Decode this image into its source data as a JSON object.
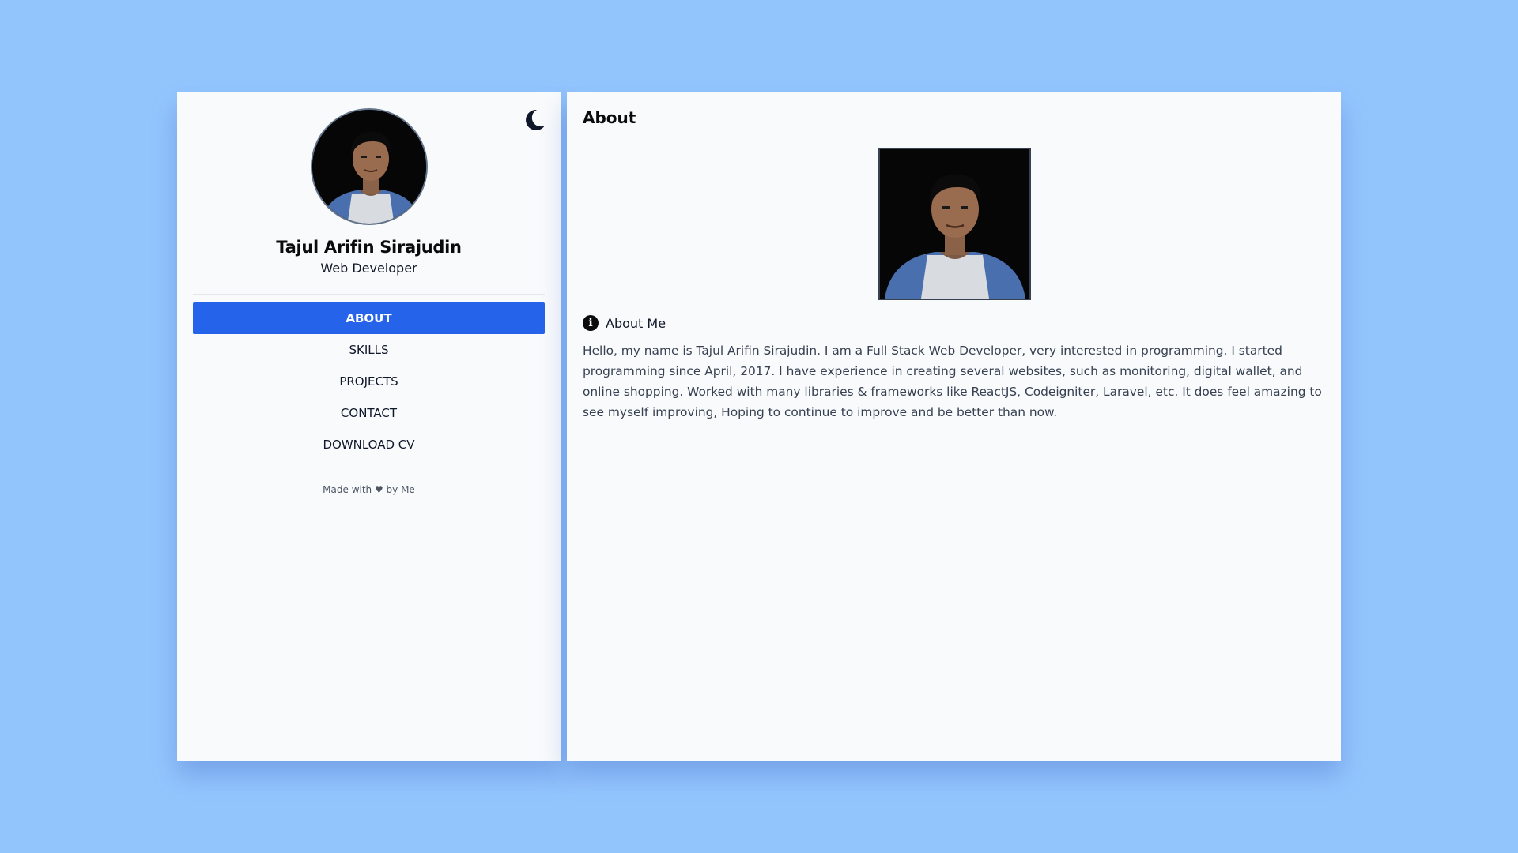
{
  "profile": {
    "name": "Tajul Arifin Sirajudin",
    "role": "Web Developer"
  },
  "theme_toggle": {
    "icon": "moon-icon"
  },
  "nav": {
    "items": [
      {
        "label": "ABOUT",
        "active": true
      },
      {
        "label": "SKILLS",
        "active": false
      },
      {
        "label": "PROJECTS",
        "active": false
      },
      {
        "label": "CONTACT",
        "active": false
      },
      {
        "label": "DOWNLOAD CV",
        "active": false
      }
    ]
  },
  "footer": {
    "credit": "Made with ♥ by Me"
  },
  "main": {
    "title": "About",
    "section_icon": "info-icon",
    "section_title": "About Me",
    "body": "Hello, my name is Tajul Arifin Sirajudin. I am a Full Stack Web Developer, very interested in programming. I started programming since April, 2017. I have experience in creating several websites, such as monitoring, digital wallet, and online shopping. Worked with many libraries & frameworks like ReactJS, Codeigniter, Laravel, etc. It does feel amazing to see myself improving, Hoping to continue to improve and be better than now."
  },
  "colors": {
    "background": "#93c5fd",
    "panel": "#f8fafc",
    "accent": "#2563eb"
  }
}
